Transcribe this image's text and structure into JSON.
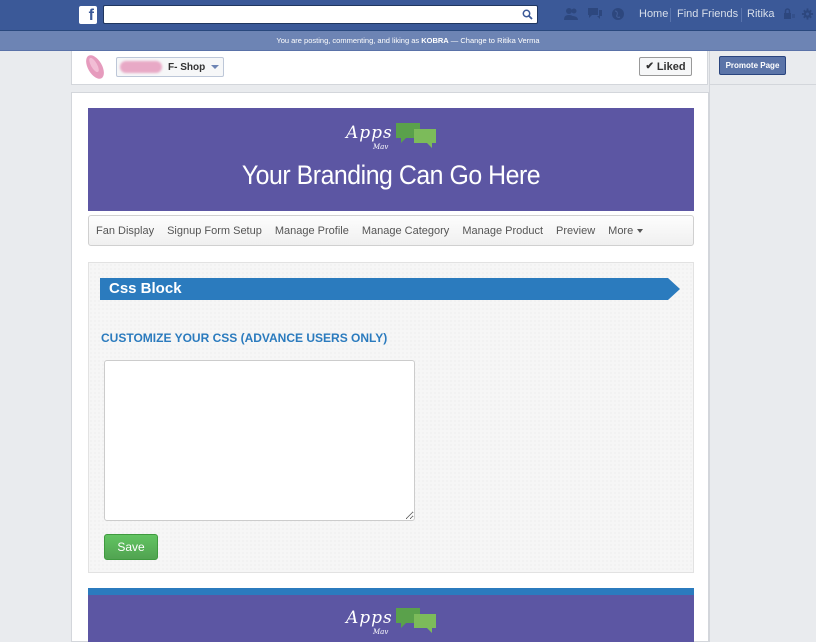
{
  "topbar": {
    "search_placeholder": "",
    "links": [
      "Home",
      "Find Friends",
      "Ritika"
    ]
  },
  "posting_bar": {
    "prefix": "You are posting, commenting, and liking as ",
    "name": "KOBRA",
    "suffix": " — Change to Ritika Verma"
  },
  "page_header": {
    "page_name": "F- Shop",
    "liked_label": "Liked",
    "promote_label": "Promote Page"
  },
  "banner": {
    "logo_text": "Apps",
    "logo_sub": "Mav",
    "branding_text": "Your Branding Can Go Here"
  },
  "nav": {
    "items": [
      "Fan Display",
      "Signup Form Setup",
      "Manage Profile",
      "Manage Category",
      "Manage Product",
      "Preview"
    ],
    "more_label": "More"
  },
  "css_block": {
    "ribbon_title": "Css Block",
    "section_title": "CUSTOMIZE YOUR CSS (ADVANCE USERS ONLY)",
    "textarea_value": "",
    "save_label": "Save"
  },
  "colors": {
    "facebook_blue": "#3b5998",
    "banner_purple": "#5c56a3",
    "accent_blue": "#2b7bbe",
    "save_green": "#51a351"
  }
}
